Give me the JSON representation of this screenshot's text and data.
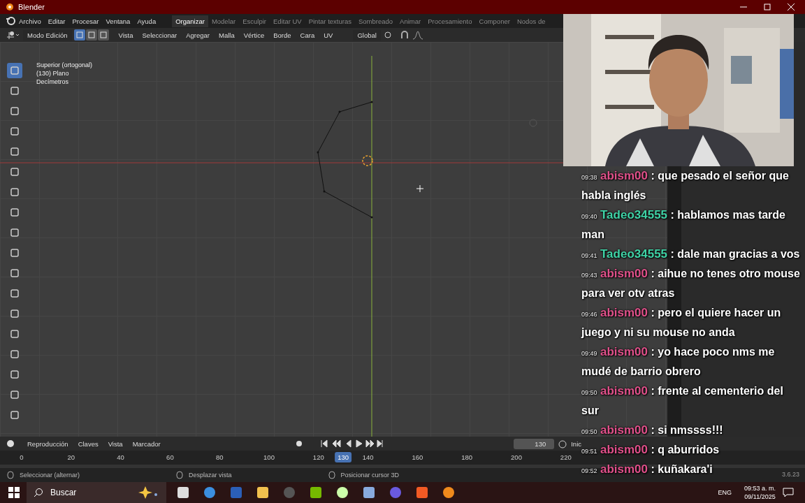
{
  "window": {
    "title": "Blender"
  },
  "menu": [
    "Archivo",
    "Editar",
    "Procesar",
    "Ventana",
    "Ayuda"
  ],
  "workspaces": [
    {
      "label": "Organizar",
      "selected": true
    },
    {
      "label": "Modelar",
      "selected": false
    },
    {
      "label": "Esculpir",
      "selected": false
    },
    {
      "label": "Editar UV",
      "selected": false
    },
    {
      "label": "Pintar texturas",
      "selected": false
    },
    {
      "label": "Sombreado",
      "selected": false
    },
    {
      "label": "Animar",
      "selected": false
    },
    {
      "label": "Procesamiento",
      "selected": false
    },
    {
      "label": "Componer",
      "selected": false
    },
    {
      "label": "Nodos de",
      "selected": false
    }
  ],
  "header": {
    "mode": "Modo Edición",
    "select_modes": [
      {
        "selected": true
      },
      {
        "selected": false
      },
      {
        "selected": false
      }
    ],
    "menus": [
      "Vista",
      "Seleccionar",
      "Agregar",
      "Malla",
      "Vértice",
      "Borde",
      "Cara",
      "UV"
    ],
    "orientation": "Global"
  },
  "viewport": {
    "info": [
      "Superior (ortogonal)",
      "(130) Plano",
      "Decímetros"
    ]
  },
  "tools": [
    {
      "selected": true
    },
    {
      "selected": false
    },
    {
      "selected": false
    },
    {
      "selected": false
    },
    {
      "selected": false
    },
    {
      "selected": false
    },
    {
      "selected": false
    },
    {
      "selected": false
    },
    {
      "selected": false
    },
    {
      "selected": false
    },
    {
      "selected": false
    },
    {
      "selected": false
    },
    {
      "selected": false
    },
    {
      "selected": false
    },
    {
      "selected": false
    },
    {
      "selected": false
    },
    {
      "selected": false
    },
    {
      "selected": false
    }
  ],
  "properties": {
    "version": "3.6.23"
  },
  "timeline": {
    "menus": [
      "Reproducción",
      "Claves",
      "Vista",
      "Marcador"
    ],
    "frame": "130",
    "start_label": "Inic",
    "ticks": [
      "0",
      "20",
      "40",
      "60",
      "80",
      "100",
      "120",
      "140",
      "160",
      "180",
      "200",
      "220"
    ],
    "playhead": "130"
  },
  "status_bar": [
    "Seleccionar (alternar)",
    "Desplazar vista",
    "Posicionar cursor 3D"
  ],
  "chat": [
    {
      "time": "09:38",
      "user": "abism00",
      "color": "#e0508a",
      "text": ": que pesado el señor que habla inglés"
    },
    {
      "time": "09:40",
      "user": "Tadeo34555",
      "color": "#3fd3a6",
      "text": ": hablamos mas tarde man"
    },
    {
      "time": "09:41",
      "user": "Tadeo34555",
      "color": "#3fd3a6",
      "text": ": dale man gracias a vos"
    },
    {
      "time": "09:43",
      "user": "abism00",
      "color": "#e0508a",
      "text": ": aihue no tenes otro mouse para ver otv atras"
    },
    {
      "time": "09:46",
      "user": "abism00",
      "color": "#e0508a",
      "text": ": pero el quiere hacer un juego y ni su mouse no anda"
    },
    {
      "time": "09:49",
      "user": "abism00",
      "color": "#e0508a",
      "text": ": yo hace poco nms me mudé de barrio obrero"
    },
    {
      "time": "09:50",
      "user": "abism00",
      "color": "#e0508a",
      "text": ": frente al cementerio del sur"
    },
    {
      "time": "09:50",
      "user": "abism00",
      "color": "#e0508a",
      "text": ": si nmssss!!!"
    },
    {
      "time": "09:51",
      "user": "abism00",
      "color": "#e0508a",
      "text": ": q aburridos"
    },
    {
      "time": "09:52",
      "user": "abism00",
      "color": "#e0508a",
      "text": ": kuñakara'i"
    }
  ],
  "taskbar": {
    "search_placeholder": "Buscar",
    "language": "ENG",
    "time": "09:53 a. m.",
    "date": "09/11/2025"
  }
}
